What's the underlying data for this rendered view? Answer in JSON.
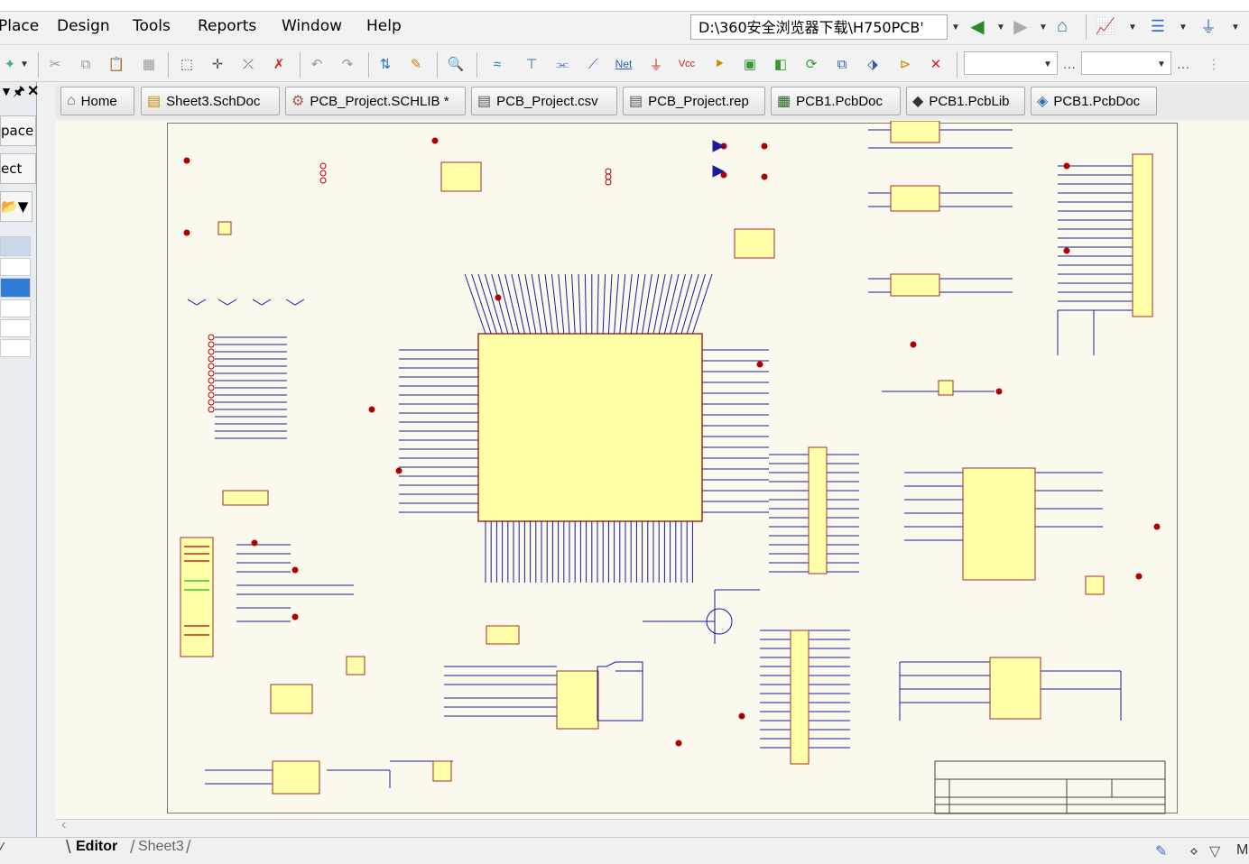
{
  "menubar": {
    "items": [
      "Place",
      "Design",
      "Tools",
      "Reports",
      "Window",
      "Help"
    ],
    "path": "D:\\360安全浏览器下载\\H750PCB'"
  },
  "toolbar": {
    "net_label": "Net",
    "vcc_label": "Vcc"
  },
  "leftpanel": {
    "workspace_label": "pace",
    "project_label": "ect"
  },
  "tabs": [
    {
      "label": "Home",
      "icon": "home-icon"
    },
    {
      "label": "Sheet3.SchDoc",
      "icon": "schematic-icon"
    },
    {
      "label": "PCB_Project.SCHLIB *",
      "icon": "schlib-icon"
    },
    {
      "label": "PCB_Project.csv",
      "icon": "document-icon"
    },
    {
      "label": "PCB_Project.rep",
      "icon": "document-icon"
    },
    {
      "label": "PCB1.PcbDoc",
      "icon": "pcb-icon"
    },
    {
      "label": "PCB1.PcbLib",
      "icon": "pcblib-icon"
    },
    {
      "label": "PCB1.PcbDoc",
      "icon": "pcb-3d-icon"
    }
  ],
  "bottom": {
    "editor_tab": "Editor",
    "sheet_tab": "Sheet3",
    "status_right": "M"
  },
  "colors": {
    "sheet_bg": "#fbf9ee",
    "wire": "#1a1a9c",
    "component_fill": "#ffffa8",
    "component_border": "#a0302c",
    "power_port": "#b00000"
  }
}
